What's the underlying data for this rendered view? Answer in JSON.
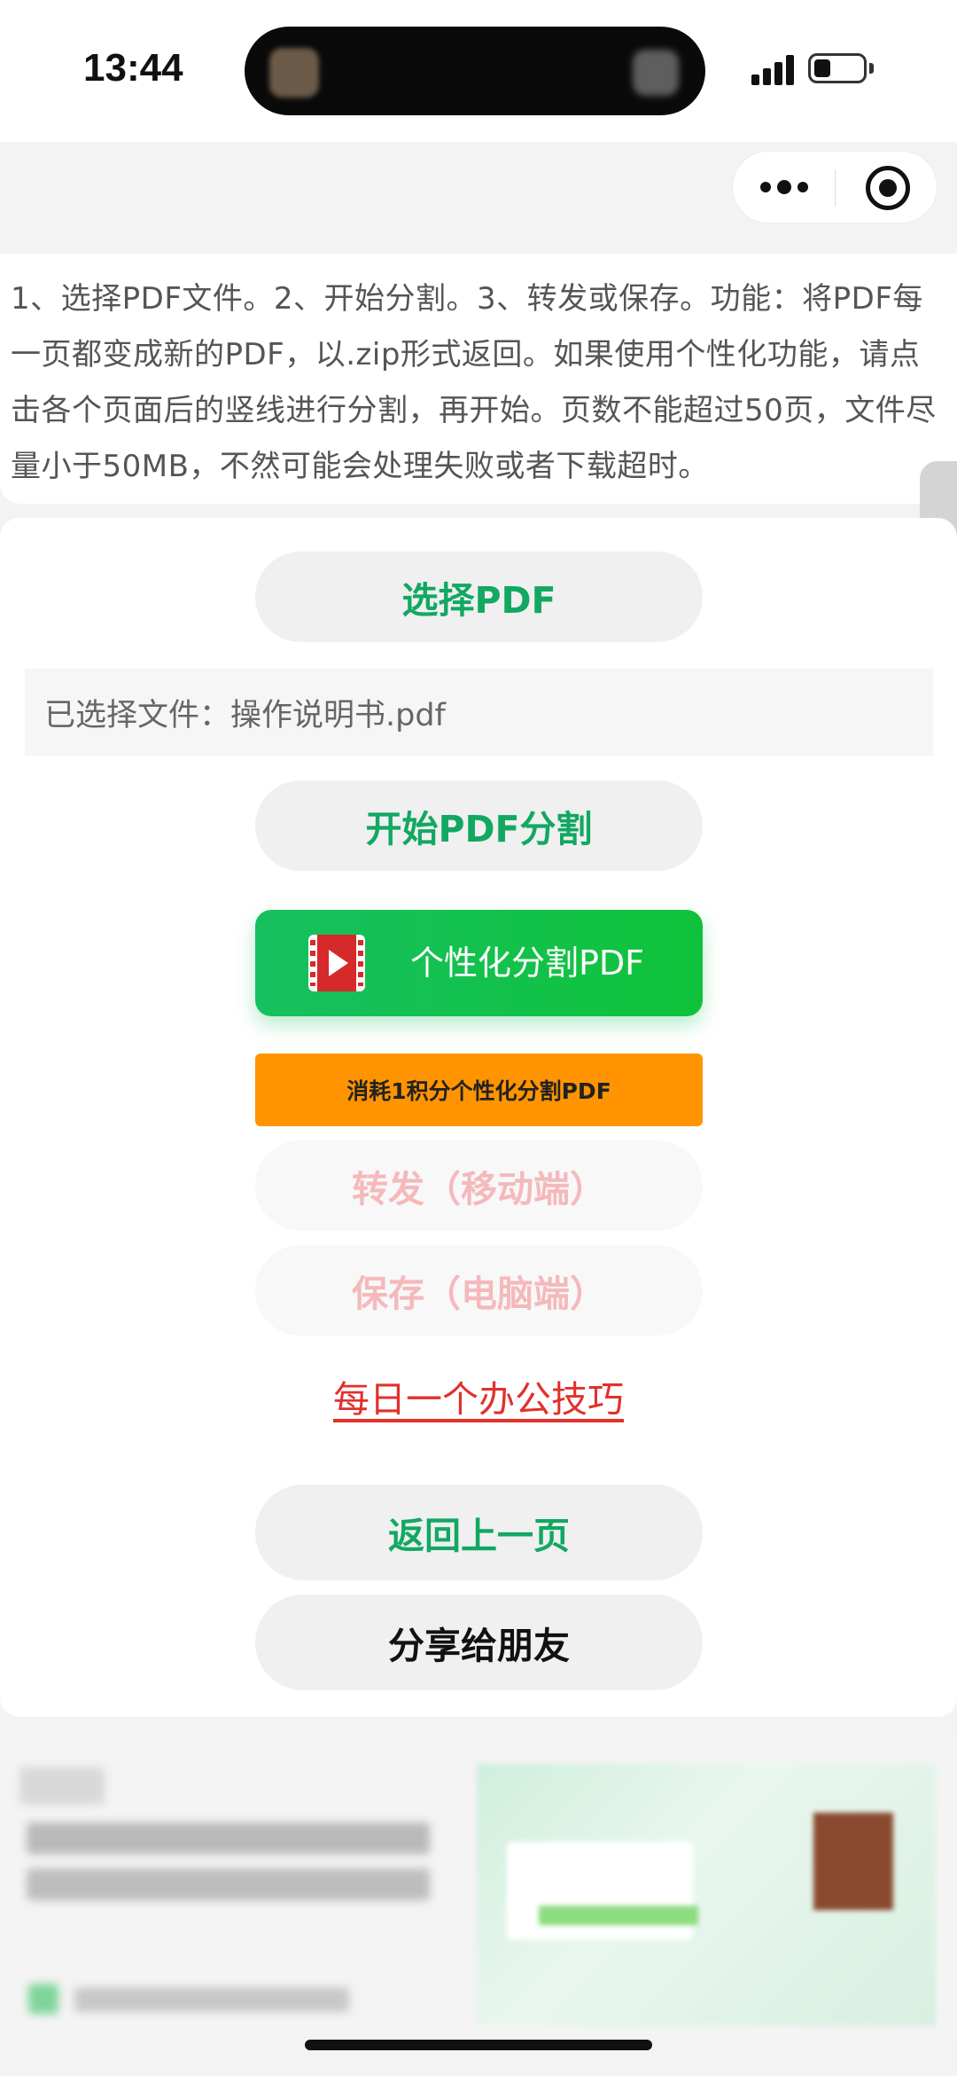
{
  "status_bar": {
    "time": "13:44"
  },
  "capsule": {
    "more_icon": "more-dots-icon",
    "close_icon": "target-close-icon"
  },
  "instructions": "1、选择PDF文件。2、开始分割。3、转发或保存。功能：将PDF每一页都变成新的PDF，以.zip形式返回。如果使用个性化功能，请点击各个页面后的竖线进行分割，再开始。页数不能超过50页，文件尽量小于50MB，不然可能会处理失败或者下载超时。",
  "buttons": {
    "select_pdf": "选择PDF",
    "start_split": "开始PDF分割",
    "custom_split": "个性化分割PDF",
    "custom_split_credit": "消耗1积分个性化分割PDF",
    "forward_mobile": "转发（移动端）",
    "save_desktop": "保存（电脑端）",
    "back": "返回上一页",
    "share": "分享给朋友"
  },
  "selected_file": "已选择文件：操作说明书.pdf",
  "daily_tip_link": "每日一个办公技巧",
  "colors": {
    "primary_green": "#12a862",
    "custom_button_green": "#16c060",
    "orange": "#ff9400",
    "link_red": "#e0312b",
    "disabled_pink": "#f5b9bb"
  }
}
